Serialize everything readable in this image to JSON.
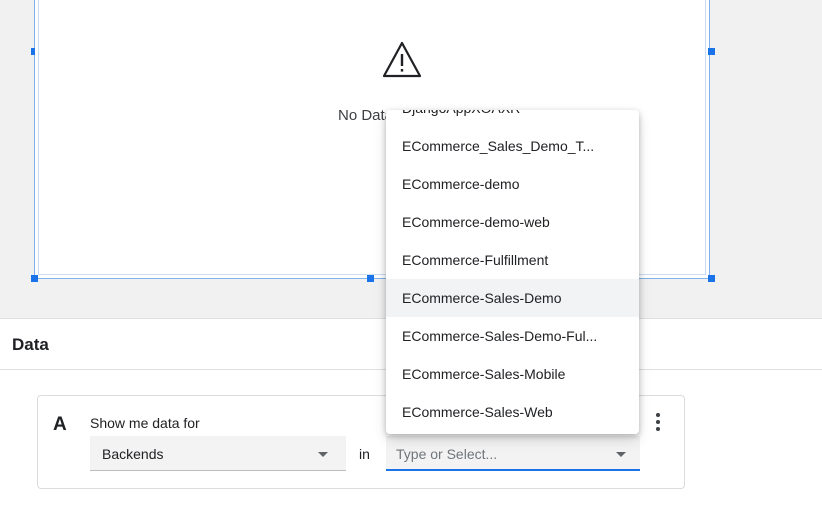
{
  "widget": {
    "message": "No Data Av"
  },
  "dropdown": {
    "items": [
      "DjangoAppXOAXR",
      "ECommerce_Sales_Demo_T...",
      "ECommerce-demo",
      "ECommerce-demo-web",
      "ECommerce-Fulfillment",
      "ECommerce-Sales-Demo",
      "ECommerce-Sales-Demo-Ful...",
      "ECommerce-Sales-Mobile",
      "ECommerce-Sales-Web"
    ],
    "highlighted": "ECommerce-Sales-Demo"
  },
  "data_panel": {
    "title": "Data",
    "query": {
      "letter": "A",
      "label": "Show me data for",
      "source_value": "Backends",
      "in_label": "in",
      "app_placeholder": "Type or Select..."
    }
  },
  "colors": {
    "accent": "#1a73e8",
    "selection_border": "#7eb2ec",
    "hover_row": "#f1f3f4"
  }
}
